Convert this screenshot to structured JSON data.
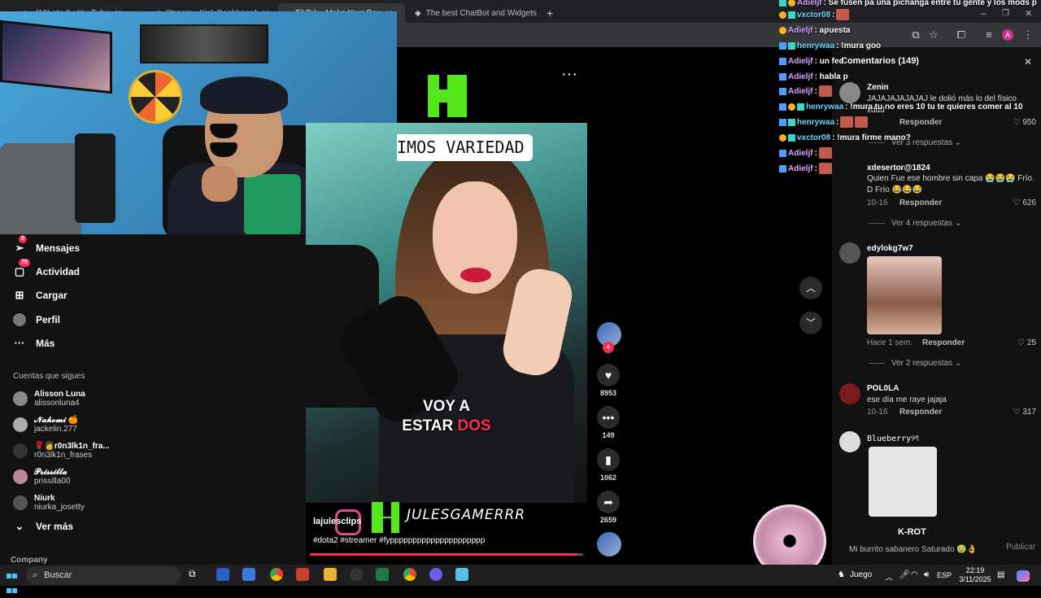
{
  "browser": {
    "tabs": [
      {
        "label": "(10) eta 6 - YouTube"
      },
      {
        "label": "Stream - Kick Dashboard"
      },
      {
        "label": "TikTok - Make Your Day"
      },
      {
        "label": "The best ChatBot and Widgets"
      }
    ],
    "new_tab": "+"
  },
  "nav": {
    "items": [
      {
        "label": "Mensajes",
        "badge": "5"
      },
      {
        "label": "Actividad",
        "badge": "70"
      },
      {
        "label": "Cargar"
      },
      {
        "label": "Perfil"
      },
      {
        "label": "Más"
      }
    ],
    "following_title": "Cuentas que sigues",
    "following": [
      {
        "name": "Alisson Luna",
        "handle": "alissonluna4"
      },
      {
        "name": "𝓝𝓪𝓱𝓸𝓶𝓲 🍊",
        "handle": "jackelin.277"
      },
      {
        "name": "🌹👩‍r0n3lk1n_fra...",
        "handle": "r0n3lk1n_frases"
      },
      {
        "name": "𝓟𝓻𝓲𝓼𝓼𝓲𝓵𝓵𝓪",
        "handle": "prissilla00"
      },
      {
        "name": "Niurk",
        "handle": "niurka_josetty"
      }
    ],
    "see_more": "Ver más",
    "company": "Company"
  },
  "video": {
    "caption_top": "IMOS VARIEDAD",
    "caption_line1": "VOY A",
    "caption_line2_a": "ESTAR ",
    "caption_line2_b": "DOS",
    "watermark": "JULESGAMERRR",
    "author": "lajulesclips",
    "tags": "#dota2 #streamer #fyppppppppppppppppppppp",
    "progress": 0.98,
    "likes": "8953",
    "comments": "149",
    "saves": "1062",
    "shares": "2659"
  },
  "chat": [
    {
      "user": "Adieljf",
      "text": ": Se fusen pa una pichanga entre tu gente y los mods p"
    },
    {
      "user": "vxctor08",
      "text": ":"
    },
    {
      "user": "Adieljf",
      "text": ": apuesta"
    },
    {
      "user": "henrywaa",
      "text": ": !mura goo"
    },
    {
      "user": "Adieljf",
      "text": ": un fed"
    },
    {
      "user": "Adieljf",
      "text": ": habla p"
    },
    {
      "user": "Adieljf",
      "text": ":"
    },
    {
      "user": "henrywaa",
      "text": ": !mura tu no eres 10 tu te quieres comer al 10"
    },
    {
      "user": "henrywaa",
      "text": ":"
    },
    {
      "user": "vxctor08",
      "text": ": !mura firme mano?"
    },
    {
      "user": "Adieljf",
      "text": ":"
    },
    {
      "user": "Adieljf",
      "text": ":"
    }
  ],
  "comments_panel": {
    "title": "Comentarios (149)",
    "comments": [
      {
        "user": "Zenin",
        "text": "JAJAJAJAJAJAJ le dolió más lo del físico xddd",
        "reply": "Responder",
        "likes": "950",
        "more": "Ver 3 respuestas"
      },
      {
        "user": "xdesertor@1824",
        "text": "Quien Fue ese hombre sin capa 😭😭😭 Frío D Frío 😂😂😂",
        "date": "10-16",
        "reply": "Responder",
        "likes": "626",
        "more": "Ver 4 respuestas"
      },
      {
        "user": "edylokg7w7",
        "date": "Hace 1 sem.",
        "reply": "Responder",
        "likes": "25",
        "more": "Ver 2 respuestas"
      },
      {
        "user": "POL0LA",
        "text": "ese día me raye jajaja",
        "date": "10-16",
        "reply": "Responder",
        "likes": "317"
      },
      {
        "user": "Blueberry୨ৎ"
      }
    ],
    "caption": "K-ROT",
    "input_text": "Mi burrito sabanero Saturado 🤢👌",
    "publish": "Publicar"
  },
  "taskbar": {
    "search": "Buscar",
    "game": "Juego",
    "lang": "ESP",
    "time": "22:19",
    "date": "3/11/2025"
  }
}
